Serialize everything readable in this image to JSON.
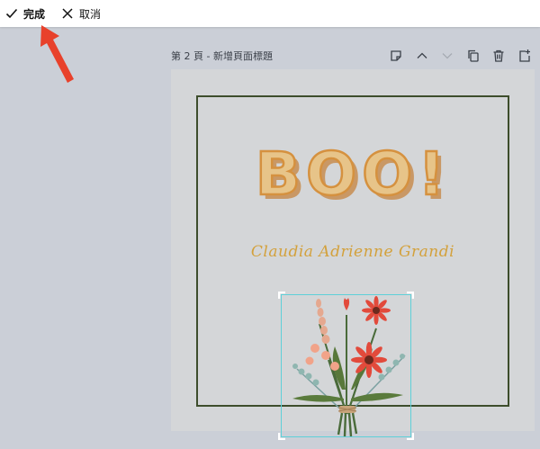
{
  "toolbar": {
    "done_label": "完成",
    "cancel_label": "取消"
  },
  "page": {
    "title": "第 2 頁 - 新增頁面標題"
  },
  "design": {
    "headline": "BOO!",
    "name": "Claudia Adrienne Grandi"
  },
  "colors": {
    "annotation_arrow": "#e8412b",
    "frame": "#3d4d2c",
    "headline_fill": "#e7c489",
    "headline_stroke": "#d5913f",
    "name": "#d3a13c",
    "selection": "#5ed0d8"
  },
  "icons": {
    "done": "check-icon",
    "cancel": "close-icon",
    "tools": [
      "note-icon",
      "chevron-up-icon",
      "chevron-down-icon",
      "duplicate-icon",
      "trash-icon",
      "add-page-icon"
    ]
  }
}
